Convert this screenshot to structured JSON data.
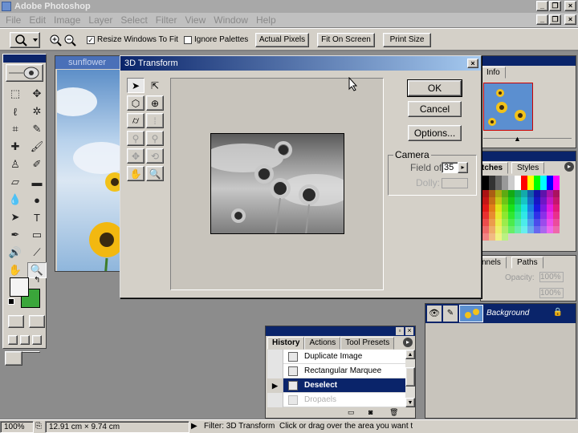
{
  "app": {
    "title": "Adobe Photoshop"
  },
  "menubar": [
    "File",
    "Edit",
    "Image",
    "Layer",
    "Select",
    "Filter",
    "View",
    "Window",
    "Help"
  ],
  "window_buttons": {
    "minimize": "_",
    "restore": "❐",
    "close": "×"
  },
  "options_bar": {
    "resize_windows": {
      "label": "Resize Windows To Fit",
      "checked": true
    },
    "ignore_palettes": {
      "label": "Ignore Palettes",
      "checked": false
    },
    "actual_pixels": "Actual Pixels",
    "fit_on_screen": "Fit On Screen",
    "print_size": "Print Size"
  },
  "image_window": {
    "title": "sunflower"
  },
  "panels": {
    "navigator_tab": "Info",
    "swatches_tabs": [
      "tches",
      "Styles"
    ],
    "layers_tabs": [
      "nnels",
      "Paths"
    ],
    "layers_opacity_label": "Opacity:",
    "layers_opacity_value": "100%",
    "layers_fill_value": "100%",
    "layer_name": "Background"
  },
  "dialog": {
    "title": "3D Transform",
    "ok": "OK",
    "cancel": "Cancel",
    "options": "Options...",
    "camera": {
      "legend": "Camera",
      "field_of_view_label": "Field of",
      "field_of_view_value": "35",
      "dolly_label": "Dolly:"
    }
  },
  "history": {
    "tabs": [
      "History",
      "Actions",
      "Tool Presets"
    ],
    "items": [
      {
        "label": "Duplicate Image",
        "state": "normal"
      },
      {
        "label": "Rectangular Marquee",
        "state": "normal"
      },
      {
        "label": "Deselect",
        "state": "selected"
      },
      {
        "label": "Dropaels",
        "state": "dim"
      }
    ]
  },
  "statusbar": {
    "zoom": "100%",
    "doc_size": "12.91 cm × 9.74 cm",
    "tool_name": "Filter: 3D Transform",
    "hint": "Click or drag over the area you want to en"
  },
  "colors": {
    "titlebar_inactive": "#a8a8a8",
    "dialog_title": "#0a246a",
    "selection": "#0a246a",
    "foreground_color": "#f4f4f4",
    "background_color": "#3aa63a"
  }
}
